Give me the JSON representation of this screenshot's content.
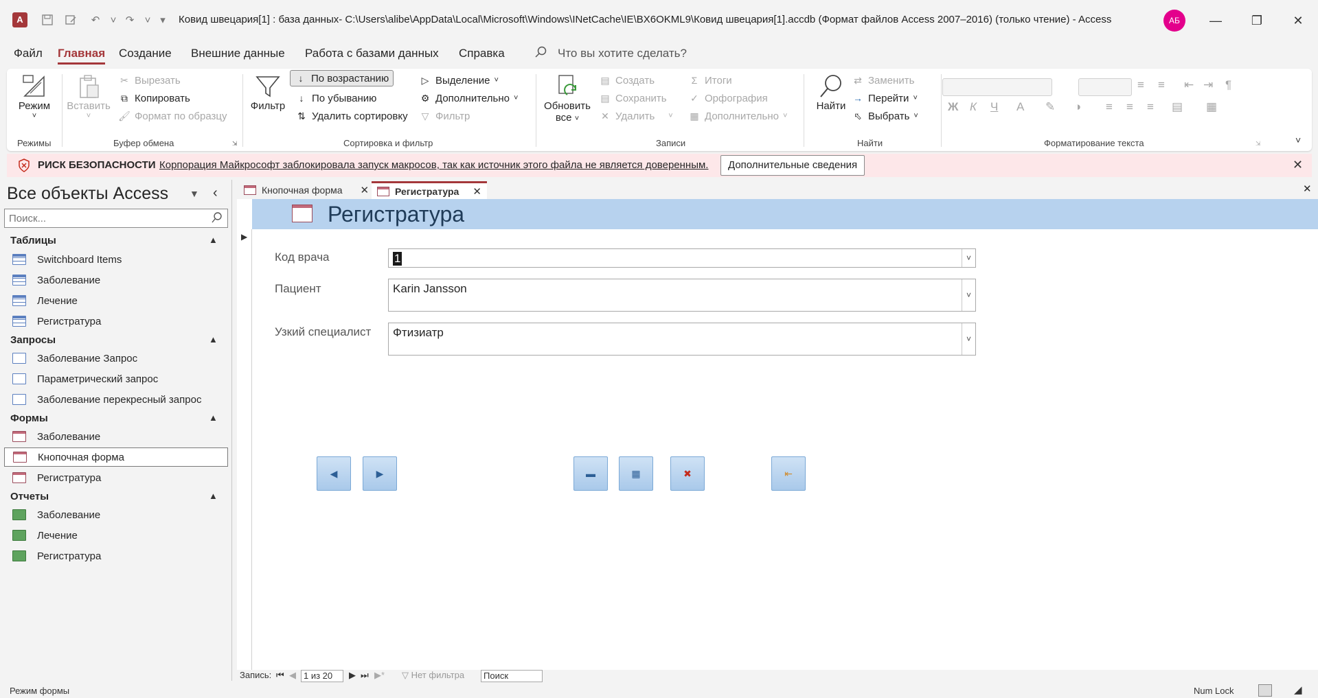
{
  "titlebar": {
    "app_icon_label": "A",
    "title": "Ковид швецария[1] : база данных- C:\\Users\\alibe\\AppData\\Local\\Microsoft\\Windows\\INetCache\\IE\\BX6OKML9\\Ковид швецария[1].accdb (Формат файлов Access 2007–2016) (только чтение)  -  Access",
    "avatar_initials": "АБ"
  },
  "ribbon_tabs": [
    "Файл",
    "Главная",
    "Создание",
    "Внешние данные",
    "Работа с базами данных",
    "Справка"
  ],
  "tell_me": "Что вы хотите сделать?",
  "ribbon": {
    "views": {
      "mode": "Режим",
      "group": "Режимы"
    },
    "clipboard": {
      "paste": "Вставить",
      "cut": "Вырезать",
      "copy": "Копировать",
      "format_painter": "Формат по образцу",
      "group": "Буфер обмена"
    },
    "sort_filter": {
      "filter": "Фильтр",
      "ascending": "По возрастанию",
      "descending": "По убыванию",
      "remove_sort": "Удалить сортировку",
      "selection": "Выделение",
      "advanced": "Дополнительно",
      "toggle_filter": "Фильтр",
      "group": "Сортировка и фильтр"
    },
    "records": {
      "refresh": "Обновить",
      "refresh2": "все",
      "new": "Создать",
      "save": "Сохранить",
      "delete": "Удалить",
      "totals": "Итоги",
      "spelling": "Орфография",
      "more": "Дополнительно",
      "group": "Записи"
    },
    "find": {
      "find": "Найти",
      "replace": "Заменить",
      "goto": "Перейти",
      "select": "Выбрать",
      "group": "Найти"
    },
    "text_format": {
      "bold": "Ж",
      "italic": "К",
      "underline": "Ч",
      "group": "Форматирование текста"
    }
  },
  "security": {
    "title": "РИСК БЕЗОПАСНОСТИ",
    "message": "Корпорация Майкрософт заблокировала запуск макросов, так как источник этого файла не является доверенным.",
    "button": "Дополнительные сведения"
  },
  "nav": {
    "title": "Все объекты Access",
    "search_placeholder": "Поиск...",
    "sections": [
      {
        "label": "Таблицы",
        "items": [
          "Switchboard Items",
          "Заболевание",
          "Лечение",
          "Регистратура"
        ]
      },
      {
        "label": "Запросы",
        "items": [
          "Заболевание Запрос",
          "Параметрический запрос",
          "Заболевание перекресный запрос"
        ]
      },
      {
        "label": "Формы",
        "items": [
          "Заболевание",
          "Кнопочная форма",
          "Регистратура"
        ]
      },
      {
        "label": "Отчеты",
        "items": [
          "Заболевание",
          "Лечение",
          "Регистратура"
        ]
      }
    ]
  },
  "doc_tabs": [
    "Кнопочная форма",
    "Регистратура"
  ],
  "form": {
    "title": "Регистратура",
    "fields": [
      {
        "label": "Код врача",
        "value": "1"
      },
      {
        "label": "Пациент",
        "value": "Karin Jansson"
      },
      {
        "label": "Узкий специалист",
        "value": "Фтизиатр"
      }
    ]
  },
  "record_nav": {
    "label": "Запись:",
    "position": "1 из 20",
    "filter": "Нет фильтра",
    "search": "Поиск"
  },
  "status": {
    "mode": "Режим формы",
    "numlock": "Num Lock"
  }
}
